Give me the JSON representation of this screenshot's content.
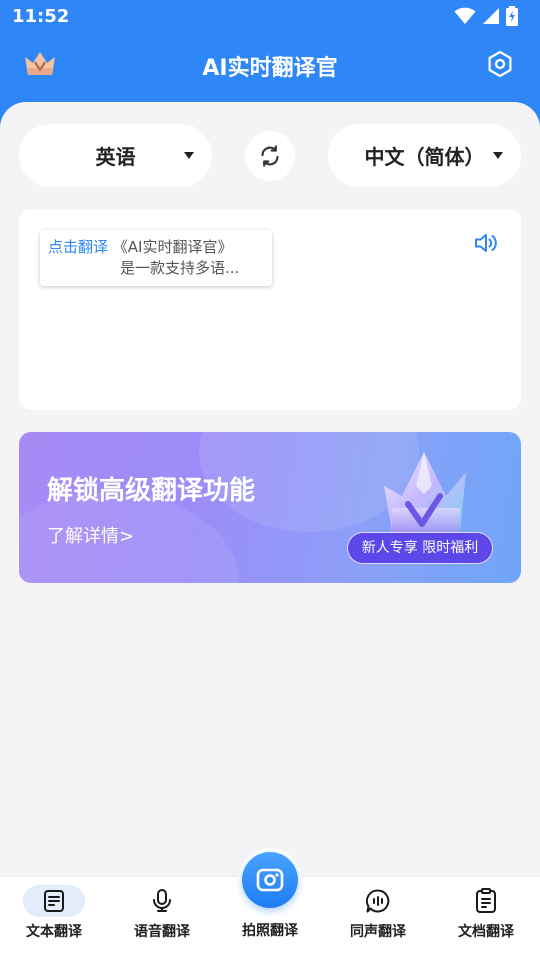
{
  "status_bar": {
    "time": "11:52"
  },
  "app_bar": {
    "title": "AI实时翻译官",
    "crown_icon": "crown-icon",
    "settings_icon": "settings-icon"
  },
  "language_selector": {
    "source_language": "英语",
    "target_language": "中文（简体）",
    "swap_icon": "swap-icon"
  },
  "text_card": {
    "tooltip_link": "点击翻译",
    "tooltip_text_line1": "《AI实时翻译官》",
    "tooltip_text_line2": "是一款支持多语...",
    "speaker_icon": "speaker-icon"
  },
  "banner": {
    "title": "解锁高级翻译功能",
    "link": "了解详情>",
    "badge": "新人专享 限时福利"
  },
  "bottom_nav": {
    "items": [
      {
        "label": "文本翻译",
        "icon": "text-translate-icon",
        "active": true
      },
      {
        "label": "语音翻译",
        "icon": "microphone-icon",
        "active": false
      },
      {
        "label": "拍照翻译",
        "icon": "camera-icon",
        "active": false
      },
      {
        "label": "同声翻译",
        "icon": "chat-bubble-icon",
        "active": false
      },
      {
        "label": "文档翻译",
        "icon": "document-icon",
        "active": false
      }
    ]
  },
  "colors": {
    "primary": "#2f86f6",
    "background": "#f4f4f6",
    "banner_badge": "#5d47e8"
  }
}
